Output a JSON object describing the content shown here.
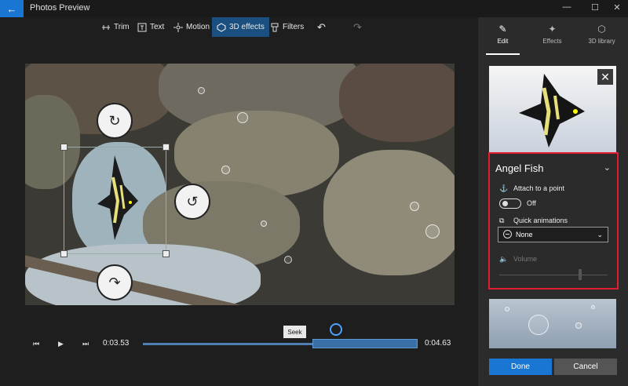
{
  "window": {
    "title": "Photos Preview",
    "back_icon": "arrow-left-icon",
    "controls": [
      "minimize",
      "maximize",
      "close"
    ],
    "controls_glyphs": [
      "—",
      "☐",
      "✕"
    ]
  },
  "toolbar": {
    "items": [
      {
        "label": "Trim",
        "icon": "trim-icon"
      },
      {
        "label": "Text",
        "icon": "text-icon"
      },
      {
        "label": "Motion",
        "icon": "motion-icon"
      },
      {
        "label": "3D effects",
        "icon": "3d-effects-icon",
        "active": true
      },
      {
        "label": "Filters",
        "icon": "filters-icon"
      }
    ],
    "undo_icon": "undo-icon",
    "redo_icon": "redo-icon"
  },
  "playback": {
    "current_time": "0:03.53",
    "end_time": "0:04.63",
    "seek_tooltip": "Seek"
  },
  "panel": {
    "tabs": [
      {
        "label": "Edit",
        "icon": "pencil-icon",
        "active": true
      },
      {
        "label": "Effects",
        "icon": "sparkle-icon"
      },
      {
        "label": "3D library",
        "icon": "cube-icon"
      }
    ],
    "object_name": "Angel Fish",
    "attach_label": "Attach to a point",
    "attach_state": "Off",
    "quick_animations_label": "Quick animations",
    "quick_animations_value": "None",
    "volume_label": "Volume",
    "done_label": "Done",
    "cancel_label": "Cancel"
  },
  "colors": {
    "accent": "#1976d2",
    "highlight_border": "#e11d2f",
    "active_tool_bg": "#1a4f80"
  }
}
